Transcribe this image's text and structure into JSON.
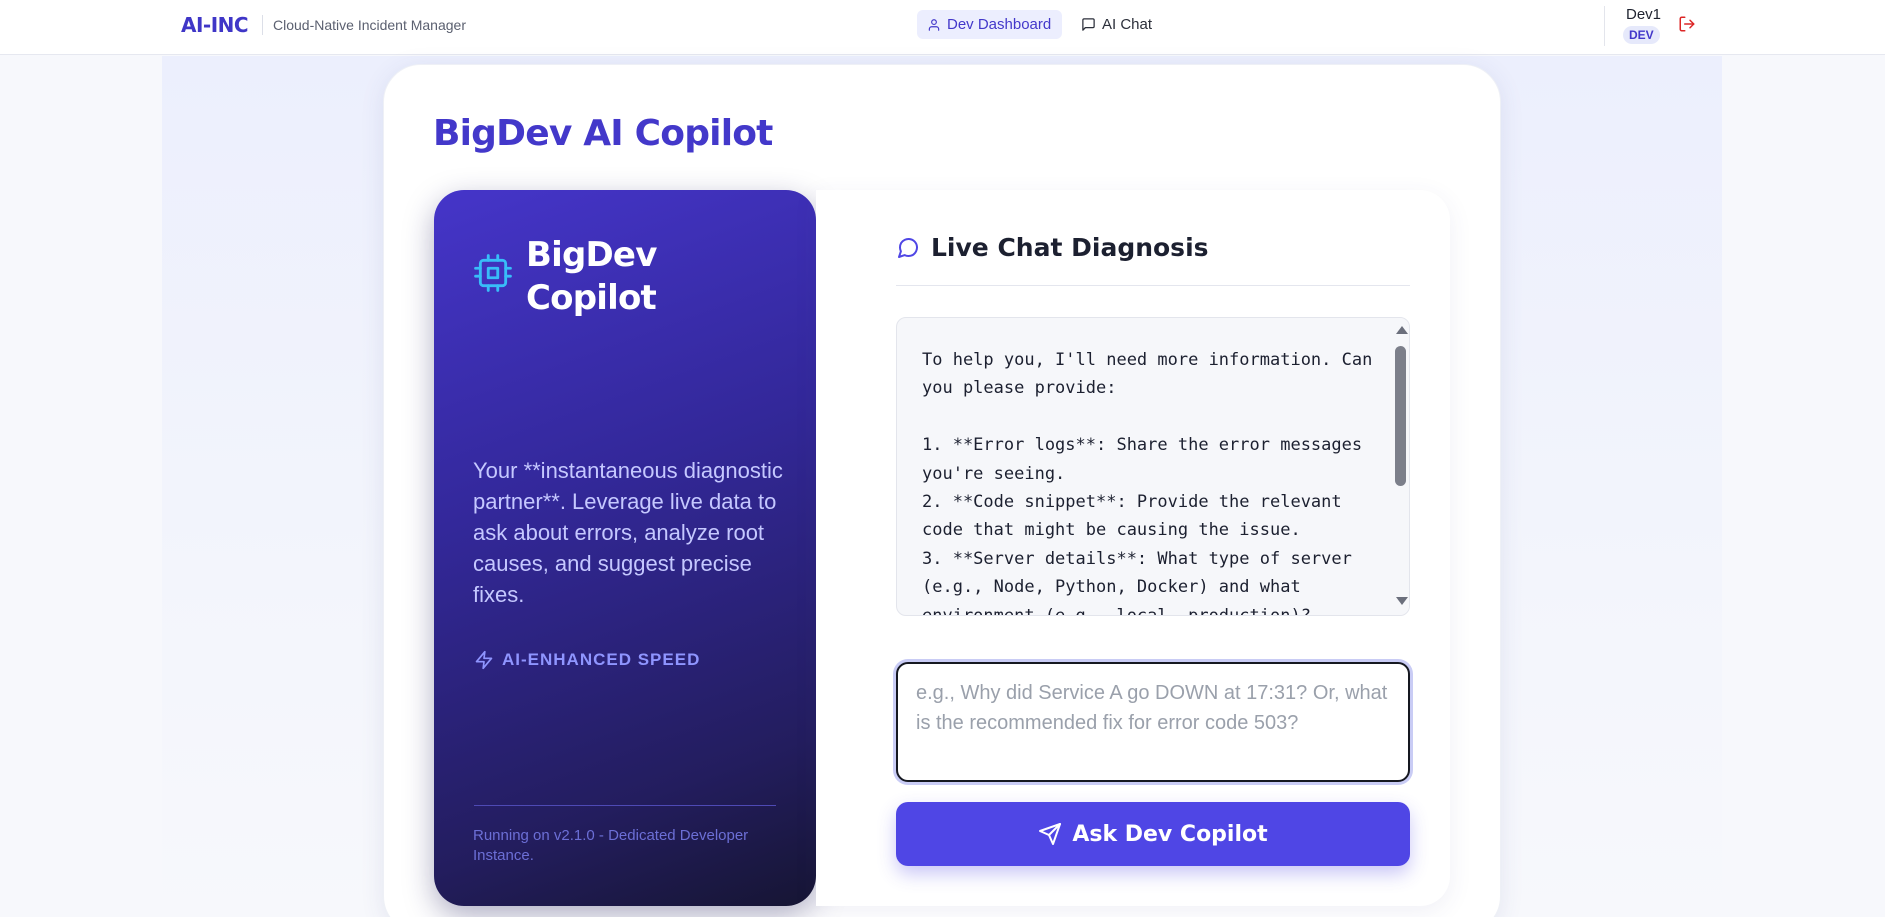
{
  "header": {
    "brand": "AI-INC",
    "subtitle": "Cloud-Native Incident Manager",
    "nav": {
      "dashboard_label": "Dev Dashboard",
      "chat_label": "AI Chat"
    },
    "user": {
      "name": "Dev1",
      "role": "DEV"
    }
  },
  "page": {
    "title": "BigDev AI Copilot"
  },
  "intro": {
    "title": "BigDev Copilot",
    "description": "Your **instantaneous diagnostic partner**. Leverage live data to ask about errors, analyze root causes, and suggest precise fixes.",
    "speed_label": "AI-ENHANCED SPEED",
    "footer": "Running on v2.1.0 - Dedicated Developer Instance."
  },
  "chat": {
    "heading": "Live Chat Diagnosis",
    "response": "To help you, I'll need more information. Can you please provide:\n\n1. **Error logs**: Share the error messages you're seeing.\n2. **Code snippet**: Provide the relevant code that might be causing the issue.\n3. **Server details**: What type of server (e.g., Node, Python, Docker) and what environment (e.g., local, production)?",
    "input_value": "",
    "input_placeholder": "e.g., Why did Service A go DOWN at 17:31? Or, what is the recommended fix for error code 503?",
    "submit_label": "Ask Dev Copilot"
  },
  "colors": {
    "brand": "#3f36c7",
    "accent": "#4f46e5",
    "logout": "#dc2626"
  },
  "icons": {
    "dashboard": "user-icon",
    "chat": "message-square-icon",
    "logout": "log-out-icon",
    "copilot": "cpu-chip-icon",
    "speed": "zap-icon",
    "chat_heading": "message-circle-icon",
    "send": "send-icon"
  }
}
